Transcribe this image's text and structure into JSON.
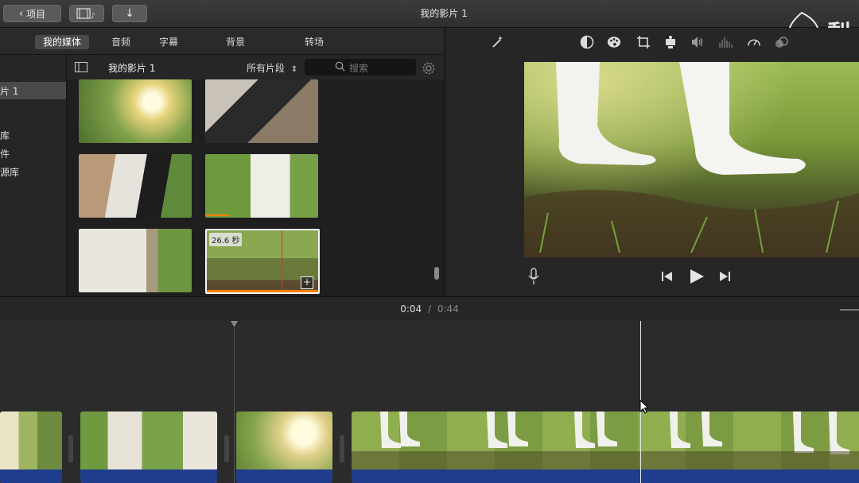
{
  "window": {
    "title": "我的影片 1"
  },
  "toolbar": {
    "back_label": "项目"
  },
  "tabs": [
    "我的媒体",
    "音频",
    "字幕",
    "背景",
    "转场"
  ],
  "sidebar": {
    "selected": "片 1",
    "items": [
      "库",
      "件",
      "源库"
    ]
  },
  "library": {
    "title": "我的影片 1",
    "filter": "所有片段",
    "search_placeholder": "搜索"
  },
  "browser": {
    "selected_duration": "26.6 秒"
  },
  "watermark": {
    "text": "梨"
  },
  "playback": {
    "current": "0:04",
    "separator": "/",
    "total": "0:44"
  },
  "colors": {
    "accent": "#ff7f00",
    "audio_bar": "#1f3d8c",
    "bg": "#1e1e1e"
  }
}
